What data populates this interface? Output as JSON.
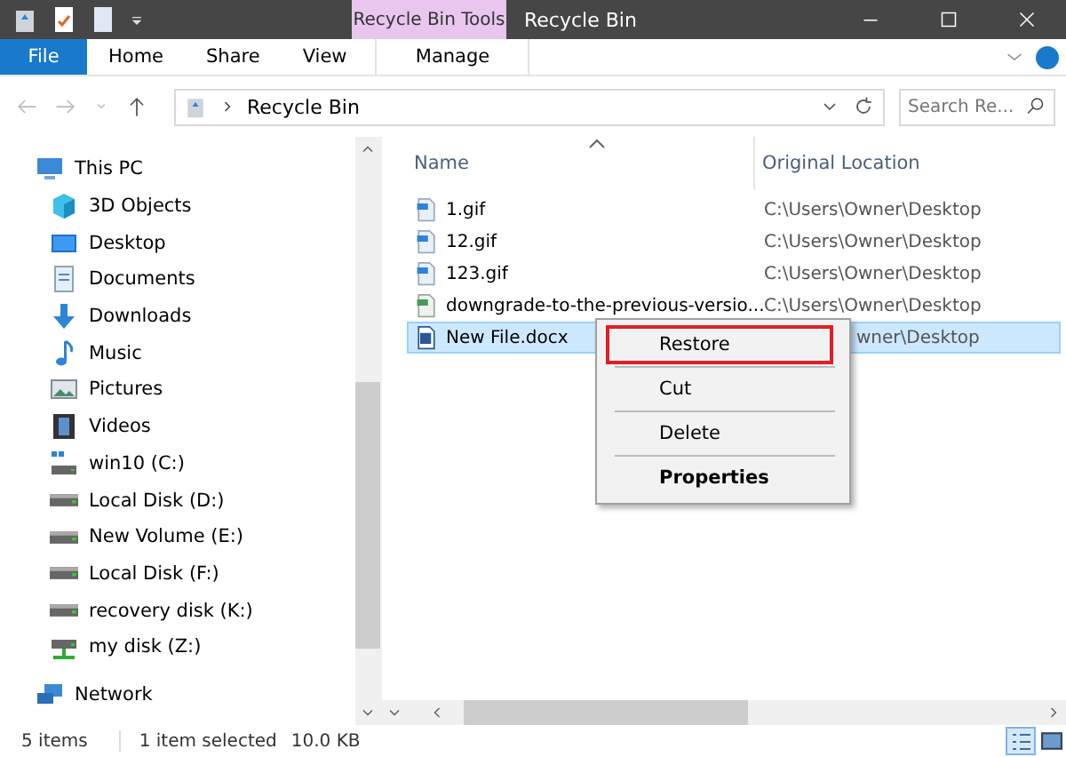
{
  "window": {
    "title": "Recycle Bin",
    "context_group": "Recycle Bin Tools"
  },
  "ribbon_tabs": [
    {
      "label": "File",
      "kind": "file"
    },
    {
      "label": "Home",
      "kind": "tab"
    },
    {
      "label": "Share",
      "kind": "tab"
    },
    {
      "label": "View",
      "kind": "tab"
    },
    {
      "label": "Manage",
      "kind": "context"
    }
  ],
  "address": {
    "path": "Recycle Bin",
    "search_placeholder": "Search Re..."
  },
  "nav": [
    {
      "label": "This PC",
      "kind": "pc",
      "children": [
        {
          "label": "3D Objects",
          "kind": "cube"
        },
        {
          "label": "Desktop",
          "kind": "desktop"
        },
        {
          "label": "Documents",
          "kind": "documents"
        },
        {
          "label": "Downloads",
          "kind": "downloads"
        },
        {
          "label": "Music",
          "kind": "music"
        },
        {
          "label": "Pictures",
          "kind": "pictures"
        },
        {
          "label": "Videos",
          "kind": "videos"
        },
        {
          "label": "win10 (C:)",
          "kind": "windrive"
        },
        {
          "label": "Local Disk (D:)",
          "kind": "drive"
        },
        {
          "label": "New Volume (E:)",
          "kind": "drive"
        },
        {
          "label": "Local Disk (F:)",
          "kind": "drive"
        },
        {
          "label": "recovery disk (K:)",
          "kind": "drive"
        },
        {
          "label": "my disk (Z:)",
          "kind": "netdrive"
        }
      ]
    },
    {
      "label": "Network",
      "kind": "network"
    }
  ],
  "table": {
    "columns": [
      "Name",
      "Original Location"
    ],
    "rows": [
      {
        "name": "1.gif",
        "location": "C:\\Users\\Owner\\Desktop",
        "kind": "image",
        "selected": false
      },
      {
        "name": "12.gif",
        "location": "C:\\Users\\Owner\\Desktop",
        "kind": "image",
        "selected": false
      },
      {
        "name": "123.gif",
        "location": "C:\\Users\\Owner\\Desktop",
        "kind": "image",
        "selected": false
      },
      {
        "name": "downgrade-to-the-previous-versio...",
        "location": "C:\\Users\\Owner\\Desktop",
        "kind": "sheet",
        "selected": false
      },
      {
        "name": "New File.docx",
        "location": "wner\\Desktop",
        "kind": "doc",
        "selected": true
      }
    ]
  },
  "context_menu": [
    {
      "label": "Restore",
      "outlined": true,
      "bold": false
    },
    {
      "label": "Cut",
      "outlined": false,
      "bold": false
    },
    {
      "label": "Delete",
      "outlined": false,
      "bold": false
    },
    {
      "label": "Properties",
      "outlined": false,
      "bold": true
    }
  ],
  "status_bar": {
    "count": "5 items",
    "selection": "1 item selected",
    "size": "10.0 KB",
    "views": [
      {
        "kind": "details",
        "selected": true
      },
      {
        "kind": "large",
        "selected": false
      }
    ]
  }
}
